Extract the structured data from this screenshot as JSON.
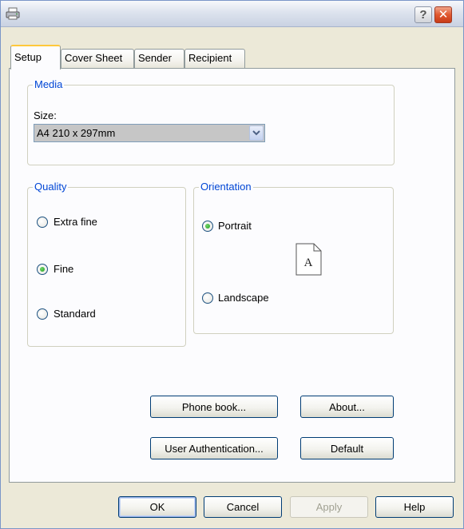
{
  "titlebar": {
    "icon": "printer-fax-icon",
    "help_label": "?",
    "close_label": "✕"
  },
  "tabs": [
    {
      "label": "Setup",
      "active": true
    },
    {
      "label": "Cover Sheet",
      "active": false
    },
    {
      "label": "Sender",
      "active": false
    },
    {
      "label": "Recipient",
      "active": false
    }
  ],
  "media": {
    "legend": "Media",
    "size_label": "Size:",
    "size_value": "A4 210 x 297mm"
  },
  "quality": {
    "legend": "Quality",
    "options": [
      {
        "label": "Extra fine",
        "checked": false
      },
      {
        "label": "Fine",
        "checked": true
      },
      {
        "label": "Standard",
        "checked": false
      }
    ]
  },
  "orientation": {
    "legend": "Orientation",
    "options": [
      {
        "label": "Portrait",
        "checked": true
      },
      {
        "label": "Landscape",
        "checked": false
      }
    ],
    "page_icon_letter": "A"
  },
  "actions": {
    "phone_book": "Phone book...",
    "about": "About...",
    "user_auth": "User Authentication...",
    "default": "Default"
  },
  "footer": {
    "ok": "OK",
    "cancel": "Cancel",
    "apply": "Apply",
    "help": "Help"
  },
  "colors": {
    "dialog_face": "#ece9d8",
    "group_legend": "#0046d5",
    "active_tab_accent": "#ffc83c",
    "close_button": "#e1582f"
  }
}
